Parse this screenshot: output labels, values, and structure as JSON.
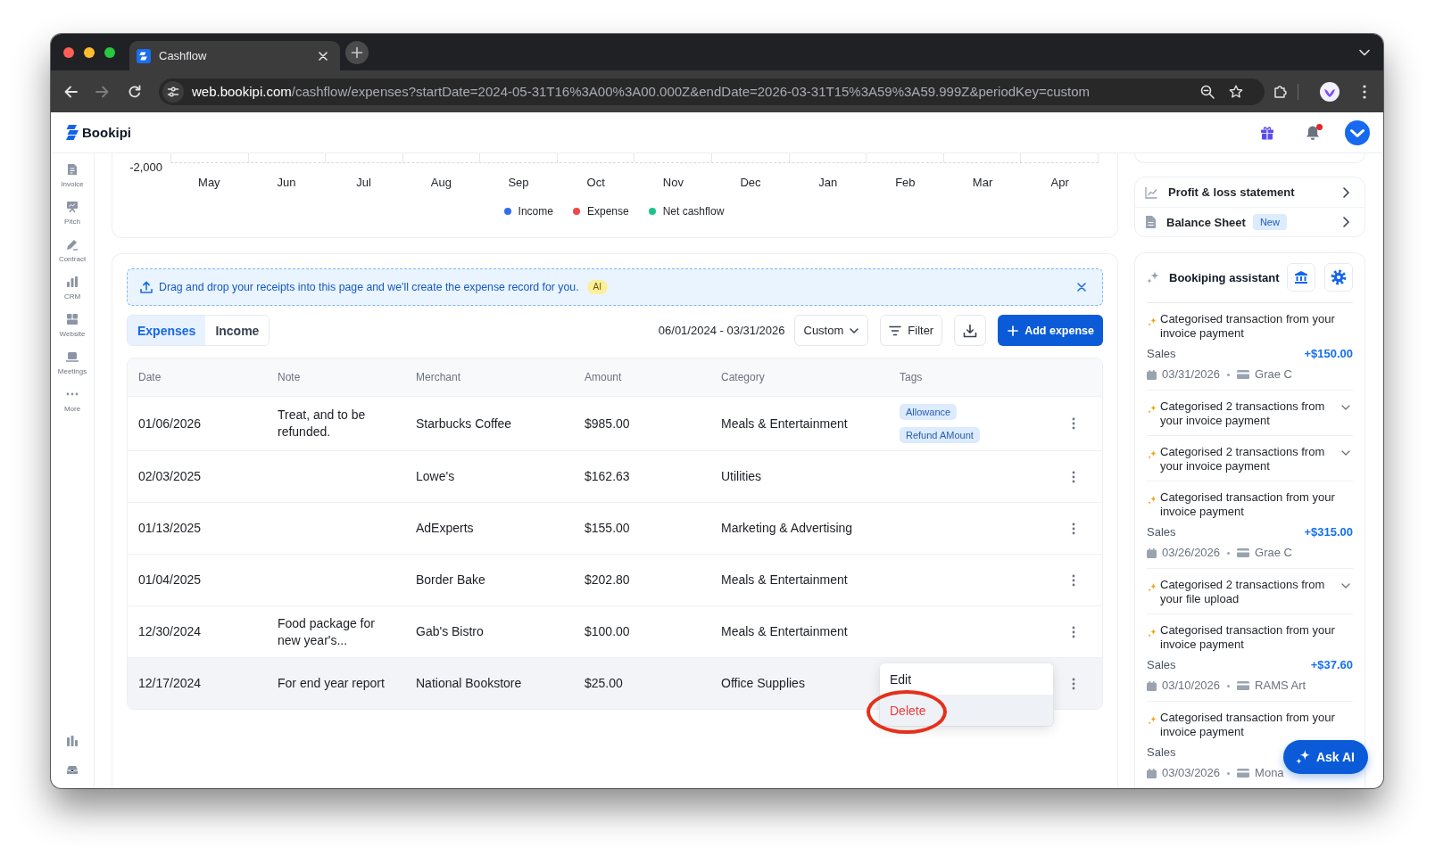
{
  "browser": {
    "tab_title": "Cashflow",
    "url_host": "web.bookipi.com",
    "url_path": "/cashflow/expenses?startDate=2024-05-31T16%3A00%3A00.000Z&endDate=2026-03-31T15%3A59%3A59.999Z&periodKey=custom"
  },
  "header": {
    "logo": "Bookipi",
    "unread_notifications": true
  },
  "sidebar": {
    "items": [
      {
        "label": "Invoice",
        "kind": "invoice"
      },
      {
        "label": "Pitch",
        "kind": "pitch"
      },
      {
        "label": "Contract",
        "kind": "contract"
      },
      {
        "label": "CRM",
        "kind": "crm"
      },
      {
        "label": "Website",
        "kind": "website"
      },
      {
        "label": "Meetings",
        "kind": "meetings"
      },
      {
        "label": "More",
        "kind": "more"
      }
    ]
  },
  "chart": {
    "y_tick": "-2,000",
    "months": [
      "May",
      "Jun",
      "Jul",
      "Aug",
      "Sep",
      "Oct",
      "Nov",
      "Dec",
      "Jan",
      "Feb",
      "Mar",
      "Apr"
    ],
    "legend": [
      {
        "label": "Income",
        "color": "#2f6fed"
      },
      {
        "label": "Expense",
        "color": "#f04747"
      },
      {
        "label": "Net cashflow",
        "color": "#1cc48a"
      }
    ]
  },
  "banner": {
    "text": "Drag and drop your receipts into this page and we'll create the expense record for you.",
    "badge": "AI"
  },
  "tabs": [
    {
      "label": "Expenses",
      "selected": true
    },
    {
      "label": "Income",
      "selected": false
    }
  ],
  "toolbar": {
    "date_range": "06/01/2024 - 03/31/2026",
    "period": "Custom",
    "filter": "Filter",
    "add": "Add expense"
  },
  "table": {
    "columns": [
      "Date",
      "Note",
      "Merchant",
      "Amount",
      "Category",
      "Tags"
    ],
    "rows": [
      {
        "date": "01/06/2026",
        "note": "Treat, and to be refunded.",
        "merchant": "Starbucks Coffee",
        "amount": "$985.00",
        "category": "Meals & Entertainment",
        "tags": [
          "Allowance",
          "Refund AMount"
        ],
        "hovered": false
      },
      {
        "date": "02/03/2025",
        "merchant": "Lowe's",
        "amount": "$162.63",
        "category": "Utilities",
        "hovered": false
      },
      {
        "date": "01/13/2025",
        "merchant": "AdExperts",
        "amount": "$155.00",
        "category": "Marketing & Advertising",
        "hovered": false
      },
      {
        "date": "01/04/2025",
        "merchant": "Border Bake",
        "amount": "$202.80",
        "category": "Meals & Entertainment",
        "hovered": false
      },
      {
        "date": "12/30/2024",
        "note": "Food package for new year's...",
        "merchant": "Gab's Bistro",
        "amount": "$100.00",
        "category": "Meals & Entertainment",
        "hovered": false
      },
      {
        "date": "12/17/2024",
        "note": "For end year report",
        "merchant": "National Bookstore",
        "amount": "$25.00",
        "category": "Office Supplies",
        "hovered": true,
        "menu": [
          {
            "label": "Edit",
            "kind": "normal",
            "hovered": false,
            "circled": false
          },
          {
            "label": "Delete",
            "kind": "danger",
            "hovered": true,
            "circled": true
          }
        ]
      }
    ]
  },
  "reports": [
    {
      "label": "Profit & loss statement",
      "kind": "chart"
    },
    {
      "label": "Balance Sheet",
      "kind": "document",
      "badge": "New"
    }
  ],
  "assistant": {
    "title": "Bookiping assistant",
    "items": [
      {
        "kind": "transaction",
        "title": "Categorised transaction from your invoice payment",
        "category": "Sales",
        "amount": "+$150.00",
        "date": "03/31/2026",
        "account": "Grae C"
      },
      {
        "kind": "group",
        "title": "Categorised 2 transactions from your invoice payment",
        "expanded": false
      },
      {
        "kind": "group",
        "title": "Categorised 2 transactions from your invoice payment",
        "expanded": false
      },
      {
        "kind": "transaction",
        "title": "Categorised transaction from your invoice payment",
        "category": "Sales",
        "amount": "+$315.00",
        "date": "03/26/2026",
        "account": "Grae C"
      },
      {
        "kind": "group",
        "title": "Categorised 2 transactions from your file upload",
        "expanded": false
      },
      {
        "kind": "transaction",
        "title": "Categorised transaction from your invoice payment",
        "category": "Sales",
        "amount": "+$37.60",
        "date": "03/10/2026",
        "account": "RAMS Art"
      },
      {
        "kind": "transaction",
        "title": "Categorised transaction from your invoice payment",
        "category": "Sales",
        "date": "03/03/2026",
        "account": "Mona"
      }
    ]
  },
  "ask_ai": "Ask AI"
}
